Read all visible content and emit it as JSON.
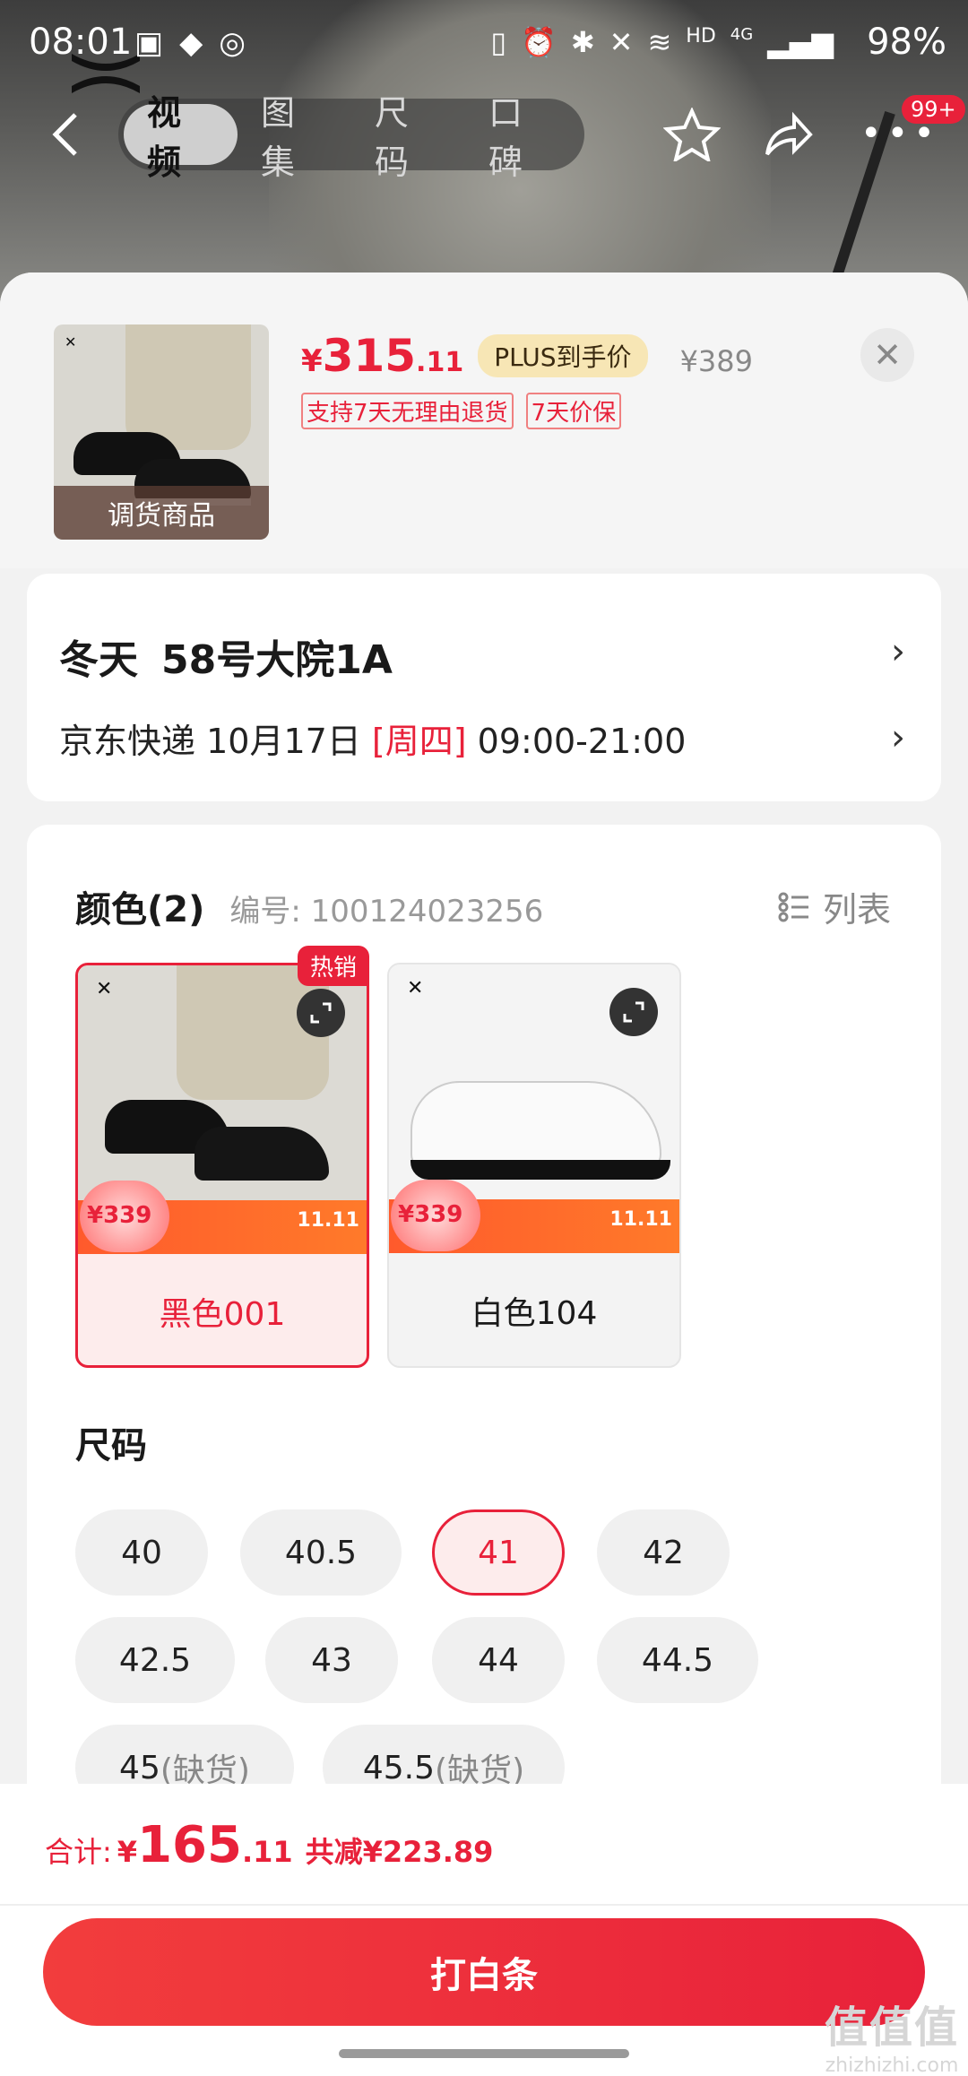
{
  "status_bar": {
    "time": "08:01",
    "battery": "98%",
    "network": "HD",
    "signal": "4G"
  },
  "nav": {
    "tabs": [
      "视频",
      "图集",
      "尺码",
      "口碑"
    ],
    "active_tab": 0,
    "badge": "99+"
  },
  "product": {
    "thumb_overlay": "调货商品",
    "price_currency": "¥",
    "price_int": "315",
    "price_dec": ".11",
    "plus_tag": "PLUS到手价",
    "original_price": "¥389",
    "promos": [
      "支持7天无理由退货",
      "7天价保"
    ],
    "close_icon": "close-icon"
  },
  "address": {
    "name": "冬天",
    "detail": "58号大院1A",
    "courier": "京东快递",
    "date": "10月17日",
    "weekday": "[周四]",
    "time_range": "09:00-21:00"
  },
  "color": {
    "title": "颜色(2)",
    "code": "编号: 100124023256",
    "list_toggle": "列表",
    "hot_tag": "热销",
    "options": [
      {
        "label": "黑色001",
        "selected": true,
        "promo_price": "¥339"
      },
      {
        "label": "白色104",
        "selected": false,
        "promo_price": "¥339"
      }
    ]
  },
  "size": {
    "title": "尺码",
    "options": [
      {
        "label": "40"
      },
      {
        "label": "40.5"
      },
      {
        "label": "41",
        "selected": true
      },
      {
        "label": "42"
      },
      {
        "label": "42.5"
      },
      {
        "label": "43"
      },
      {
        "label": "44"
      },
      {
        "label": "44.5"
      },
      {
        "label": "45",
        "suffix": "(缺货)"
      },
      {
        "label": "45.5",
        "suffix": "(缺货)"
      }
    ]
  },
  "footer": {
    "total_label": "合计:",
    "total_currency": "¥",
    "total_int": "165",
    "total_dec": ".11",
    "saved": "共减¥223.89",
    "pay_button": "打白条"
  },
  "watermark": {
    "main": "值值值",
    "site": "zhizhizhi.com"
  },
  "colors": {
    "accent": "#e8213a",
    "plus_tag_bg": "#f7e6b5"
  }
}
